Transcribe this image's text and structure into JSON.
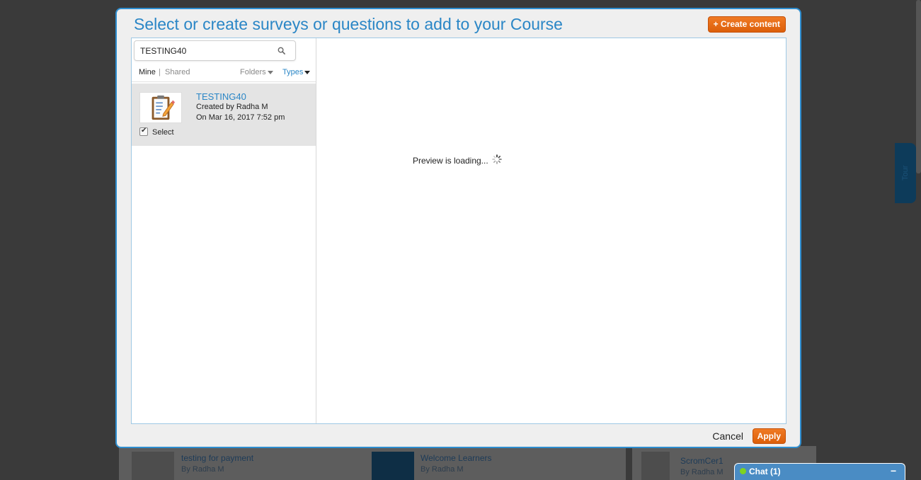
{
  "background": {
    "cards": [
      {
        "title": "testing for payment",
        "by": "By Radha M"
      },
      {
        "title": "Welcome Learners",
        "by": "By Radha M"
      },
      {
        "title": "ScromCer1",
        "by": "By Radha M"
      }
    ],
    "tour_label": "Tour"
  },
  "modal": {
    "title": "Select or create surveys or questions to add to your Course",
    "create_label": "+ Create content",
    "search": {
      "value": "TESTING40"
    },
    "filters": {
      "mine": "Mine",
      "separator": "|",
      "shared": "Shared",
      "folders": "Folders",
      "types": "Types"
    },
    "items": [
      {
        "title": "TESTING40",
        "created_by": "Created by Radha M",
        "date": "On Mar 16, 2017 7:52 pm",
        "select_label": "Select",
        "selected": true
      }
    ],
    "preview_text": "Preview is loading...",
    "cancel_label": "Cancel",
    "apply_label": "Apply"
  },
  "chat": {
    "label": "Chat  (1)",
    "minimize": "−"
  },
  "colors": {
    "accent": "#2a86c6",
    "button": "#e8690f",
    "chat": "#4a8cc4"
  }
}
